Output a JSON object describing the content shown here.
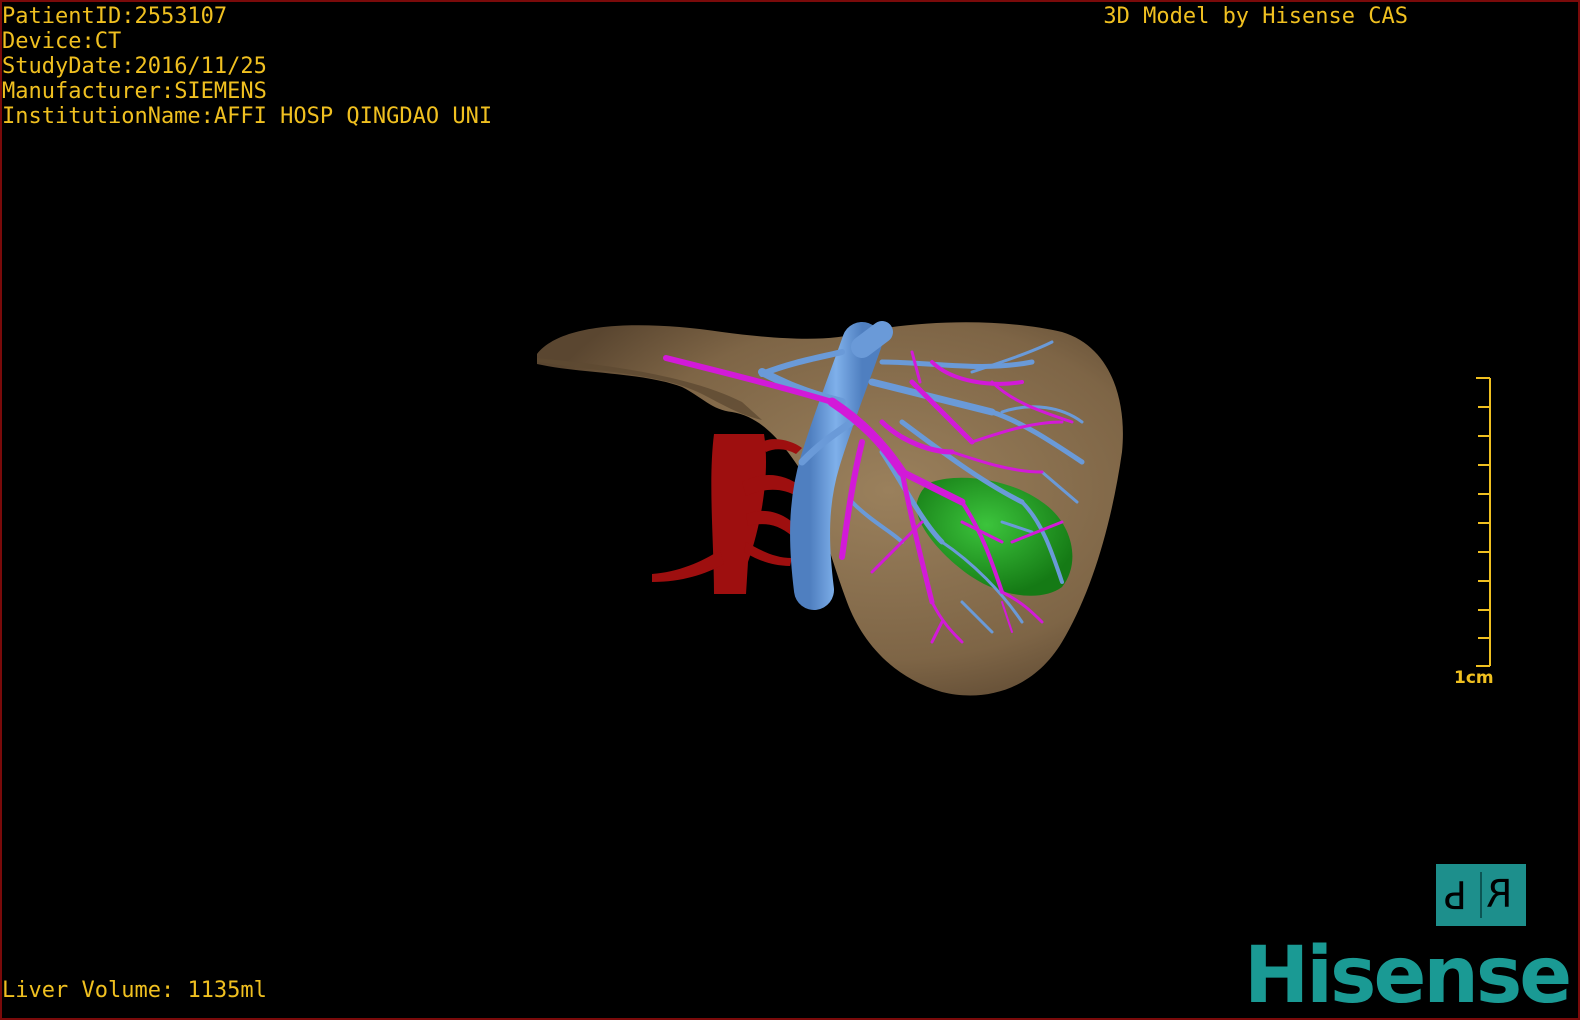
{
  "header": {
    "patient_id_label": "PatientID:",
    "patient_id": "2553107",
    "device_label": "Device:",
    "device": "CT",
    "study_date_label": "StudyDate:",
    "study_date": "2016/11/25",
    "manufacturer_label": "Manufacturer:",
    "manufacturer": "SIEMENS",
    "institution_label": "InstitutionName:",
    "institution": "AFFI HOSP QINGDAO UNI"
  },
  "watermark": "3D Model by Hisense CAS",
  "footer": {
    "liver_volume_label": "Liver Volume:",
    "liver_volume": "1135ml"
  },
  "scale": {
    "label": "1cm",
    "ticks": 10
  },
  "orientation": {
    "left_letter": "P",
    "right_letter": "R"
  },
  "brand": "Hisense",
  "colors": {
    "overlay_text": "#f0c020",
    "liver": "#8a7050",
    "portal_vein": "#6a9ad8",
    "hepatic_vessels": "#d020d8",
    "artery": "#a01010",
    "tumor": "#20a020",
    "brand": "#1a9a94",
    "border": "#7a0a0a"
  },
  "model_parts": [
    "liver",
    "portal-vein",
    "hepatic-vessels",
    "artery",
    "tumor"
  ]
}
